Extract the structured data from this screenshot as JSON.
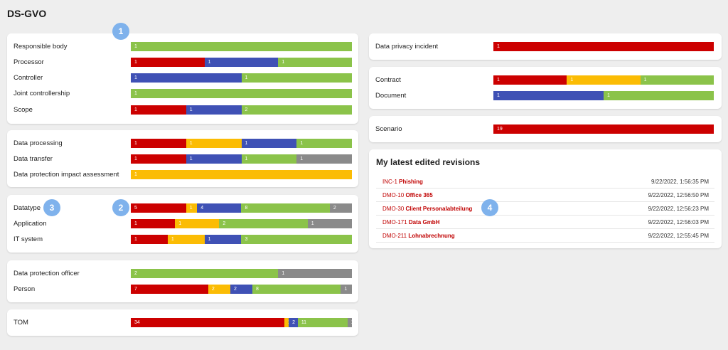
{
  "page": {
    "title": "DS-GVO"
  },
  "colors": {
    "red": "#cc0000",
    "yellow": "#fbbc04",
    "blue": "#3f51b5",
    "green": "#8bc34a",
    "grey": "#8a8a8a"
  },
  "left_cards": [
    {
      "rows": [
        {
          "label": "Responsible body",
          "segments": [
            {
              "color": "green",
              "value": 1
            }
          ]
        },
        {
          "label": "Processor",
          "segments": [
            {
              "color": "red",
              "value": 1
            },
            {
              "color": "blue",
              "value": 1
            },
            {
              "color": "green",
              "value": 1
            }
          ]
        },
        {
          "label": "Controller",
          "segments": [
            {
              "color": "blue",
              "value": 1
            },
            {
              "color": "green",
              "value": 1
            }
          ]
        },
        {
          "label": "Joint controllership",
          "segments": [
            {
              "color": "green",
              "value": 1
            }
          ]
        },
        {
          "label": "Scope",
          "segments": [
            {
              "color": "red",
              "value": 1
            },
            {
              "color": "blue",
              "value": 1
            },
            {
              "color": "green",
              "value": 2
            }
          ]
        }
      ]
    },
    {
      "rows": [
        {
          "label": "Data processing",
          "segments": [
            {
              "color": "red",
              "value": 1
            },
            {
              "color": "yellow",
              "value": 1
            },
            {
              "color": "blue",
              "value": 1
            },
            {
              "color": "green",
              "value": 1
            }
          ]
        },
        {
          "label": "Data transfer",
          "segments": [
            {
              "color": "red",
              "value": 1
            },
            {
              "color": "blue",
              "value": 1
            },
            {
              "color": "green",
              "value": 1
            },
            {
              "color": "grey",
              "value": 1
            }
          ]
        },
        {
          "label": "Data protection impact assessment",
          "segments": [
            {
              "color": "yellow",
              "value": 1
            }
          ]
        }
      ]
    },
    {
      "rows": [
        {
          "label": "Datatype",
          "segments": [
            {
              "color": "red",
              "value": 5
            },
            {
              "color": "yellow",
              "value": 1
            },
            {
              "color": "blue",
              "value": 4
            },
            {
              "color": "green",
              "value": 8
            },
            {
              "color": "grey",
              "value": 2
            }
          ]
        },
        {
          "label": "Application",
          "segments": [
            {
              "color": "red",
              "value": 1
            },
            {
              "color": "yellow",
              "value": 1
            },
            {
              "color": "green",
              "value": 2
            },
            {
              "color": "grey",
              "value": 1
            }
          ]
        },
        {
          "label": "IT system",
          "segments": [
            {
              "color": "red",
              "value": 1
            },
            {
              "color": "yellow",
              "value": 1
            },
            {
              "color": "blue",
              "value": 1
            },
            {
              "color": "green",
              "value": 3
            }
          ]
        }
      ]
    },
    {
      "rows": [
        {
          "label": "Data protection officer",
          "segments": [
            {
              "color": "green",
              "value": 2
            },
            {
              "color": "grey",
              "value": 1
            }
          ]
        },
        {
          "label": "Person",
          "segments": [
            {
              "color": "red",
              "value": 7
            },
            {
              "color": "yellow",
              "value": 2
            },
            {
              "color": "blue",
              "value": 2
            },
            {
              "color": "green",
              "value": 8
            },
            {
              "color": "grey",
              "value": 1
            }
          ]
        }
      ]
    },
    {
      "rows": [
        {
          "label": "TOM",
          "segments": [
            {
              "color": "red",
              "value": 34
            },
            {
              "color": "yellow",
              "value": 1
            },
            {
              "color": "blue",
              "value": 2
            },
            {
              "color": "green",
              "value": 11
            },
            {
              "color": "grey",
              "value": 1
            }
          ]
        }
      ]
    }
  ],
  "right_cards": [
    {
      "rows": [
        {
          "label": "Data privacy incident",
          "segments": [
            {
              "color": "red",
              "value": 1
            }
          ]
        }
      ]
    },
    {
      "rows": [
        {
          "label": "Contract",
          "segments": [
            {
              "color": "red",
              "value": 1
            },
            {
              "color": "yellow",
              "value": 1
            },
            {
              "color": "green",
              "value": 1
            }
          ]
        },
        {
          "label": "Document",
          "segments": [
            {
              "color": "blue",
              "value": 1
            },
            {
              "color": "green",
              "value": 1
            }
          ]
        }
      ]
    },
    {
      "rows": [
        {
          "label": "Scenario",
          "segments": [
            {
              "color": "red",
              "value": 19
            }
          ]
        }
      ]
    }
  ],
  "revisions": {
    "title": "My latest edited revisions",
    "items": [
      {
        "id": "INC-1",
        "name": "Phishing",
        "date": "9/22/2022, 1:56:35 PM"
      },
      {
        "id": "DMO-10",
        "name": "Office 365",
        "date": "9/22/2022, 12:56:50 PM"
      },
      {
        "id": "DMO-30",
        "name": "Client Personalabteilung",
        "date": "9/22/2022, 12:56:23 PM"
      },
      {
        "id": "DMO-171",
        "name": "Data GmbH",
        "date": "9/22/2022, 12:56:03 PM"
      },
      {
        "id": "DMO-211",
        "name": "Lohnabrechnung",
        "date": "9/22/2022, 12:55:45 PM"
      }
    ]
  },
  "markers": [
    "1",
    "2",
    "3",
    "4"
  ]
}
